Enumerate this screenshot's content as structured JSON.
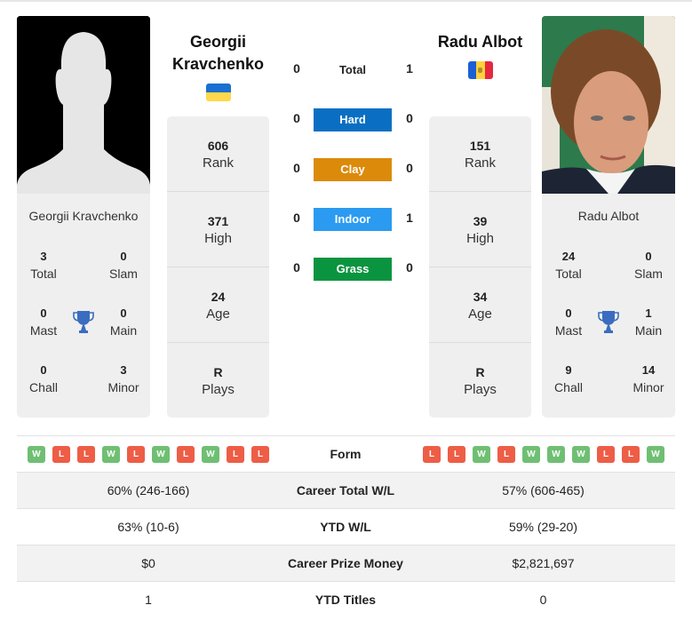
{
  "colors": {
    "hard": "#0a6fc2",
    "clay": "#dc8a0a",
    "indoor": "#2a9bf0",
    "grass": "#0b9440",
    "win": "#6fbf73",
    "loss": "#ee5d46",
    "trophy": "#3a6dbf"
  },
  "player1": {
    "name": "Georgii Kravchenko",
    "name_line1": "Georgii",
    "name_line2": "Kravchenko",
    "flag": "ukraine-flag",
    "photo": "silhouette-placeholder",
    "titles": {
      "total": {
        "value": "3",
        "label": "Total"
      },
      "slam": {
        "value": "0",
        "label": "Slam"
      },
      "mast": {
        "value": "0",
        "label": "Mast"
      },
      "main": {
        "value": "0",
        "label": "Main"
      },
      "chall": {
        "value": "0",
        "label": "Chall"
      },
      "minor": {
        "value": "3",
        "label": "Minor"
      }
    },
    "info": [
      {
        "value": "606",
        "label": "Rank"
      },
      {
        "value": "371",
        "label": "High"
      },
      {
        "value": "24",
        "label": "Age"
      },
      {
        "value": "R",
        "label": "Plays"
      }
    ]
  },
  "player2": {
    "name": "Radu Albot",
    "flag": "moldova-flag",
    "photo": "player-photo",
    "titles": {
      "total": {
        "value": "24",
        "label": "Total"
      },
      "slam": {
        "value": "0",
        "label": "Slam"
      },
      "mast": {
        "value": "0",
        "label": "Mast"
      },
      "main": {
        "value": "1",
        "label": "Main"
      },
      "chall": {
        "value": "9",
        "label": "Chall"
      },
      "minor": {
        "value": "14",
        "label": "Minor"
      }
    },
    "info": [
      {
        "value": "151",
        "label": "Rank"
      },
      {
        "value": "39",
        "label": "High"
      },
      {
        "value": "34",
        "label": "Age"
      },
      {
        "value": "R",
        "label": "Plays"
      }
    ]
  },
  "h2h": [
    {
      "label": "Total",
      "p1": "0",
      "p2": "1",
      "surface": "total"
    },
    {
      "label": "Hard",
      "p1": "0",
      "p2": "0",
      "surface": "hard"
    },
    {
      "label": "Clay",
      "p1": "0",
      "p2": "0",
      "surface": "clay"
    },
    {
      "label": "Indoor",
      "p1": "0",
      "p2": "1",
      "surface": "indoor"
    },
    {
      "label": "Grass",
      "p1": "0",
      "p2": "0",
      "surface": "grass"
    }
  ],
  "comparison": {
    "form": {
      "label": "Form",
      "p1": [
        "W",
        "L",
        "L",
        "W",
        "L",
        "W",
        "L",
        "W",
        "L",
        "L"
      ],
      "p2": [
        "L",
        "L",
        "W",
        "L",
        "W",
        "W",
        "W",
        "L",
        "L",
        "W"
      ]
    },
    "rows": [
      {
        "label": "Career Total W/L",
        "p1": "60% (246-166)",
        "p2": "57% (606-465)"
      },
      {
        "label": "YTD W/L",
        "p1": "63% (10-6)",
        "p2": "59% (29-20)"
      },
      {
        "label": "Career Prize Money",
        "p1": "$0",
        "p2": "$2,821,697"
      },
      {
        "label": "YTD Titles",
        "p1": "1",
        "p2": "0"
      }
    ]
  }
}
